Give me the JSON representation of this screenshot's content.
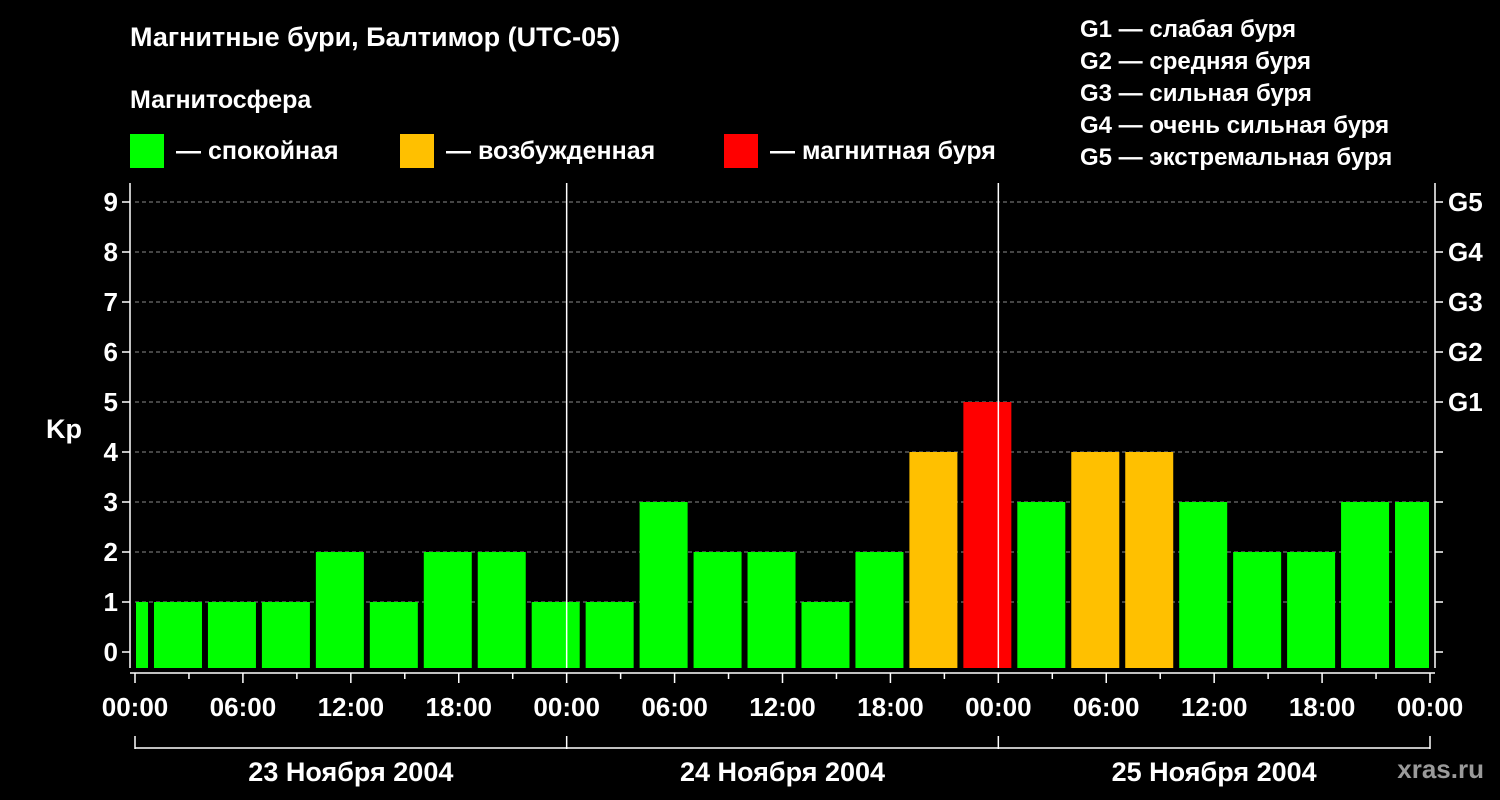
{
  "chart_data": {
    "type": "bar",
    "title": "Магнитные бури, Балтимор (UTC-05)",
    "legend_title": "Магнитосфера",
    "legend": [
      {
        "label": "— спокойная",
        "color": "#00ff00"
      },
      {
        "label": "— возбужденная",
        "color": "#ffc000"
      },
      {
        "label": "— магнитная буря",
        "color": "#ff0000"
      }
    ],
    "g_scale": [
      "G1 — слабая буря",
      "G2 — средняя буря",
      "G3 — сильная буря",
      "G4 — очень сильная буря",
      "G5 — экстремальная буря"
    ],
    "ylabel": "Kp",
    "ylim": [
      0,
      9
    ],
    "yticks": [
      "0",
      "1",
      "2",
      "3",
      "4",
      "5",
      "6",
      "7",
      "8",
      "9"
    ],
    "right_ticks": [
      {
        "value": 5,
        "label": "G1"
      },
      {
        "value": 6,
        "label": "G2"
      },
      {
        "value": 7,
        "label": "G3"
      },
      {
        "value": 8,
        "label": "G4"
      },
      {
        "value": 9,
        "label": "G5"
      }
    ],
    "xlim_hours": [
      0,
      72
    ],
    "xtick_labels": [
      "00:00",
      "06:00",
      "12:00",
      "18:00",
      "00:00",
      "06:00",
      "12:00",
      "18:00",
      "00:00",
      "06:00",
      "12:00",
      "18:00",
      "00:00"
    ],
    "days": [
      "23 Ноября 2004",
      "24 Ноября 2004",
      "25 Ноября 2004"
    ],
    "grid": "horizontal dashed",
    "bar_start_hours": [
      -2,
      1,
      4,
      7,
      10,
      13,
      16,
      19,
      22,
      25,
      28,
      31,
      34,
      37,
      40,
      43,
      46,
      49,
      52,
      55,
      58,
      61,
      64,
      67,
      70
    ],
    "values": [
      1,
      1,
      1,
      1,
      2,
      1,
      2,
      2,
      1,
      1,
      3,
      2,
      2,
      1,
      2,
      4,
      5,
      3,
      4,
      4,
      3,
      2,
      2,
      3,
      3
    ],
    "colors": {
      "quiet": "#00ff00",
      "active": "#ffc000",
      "storm": "#ff0000"
    }
  },
  "watermark": "xras.ru"
}
